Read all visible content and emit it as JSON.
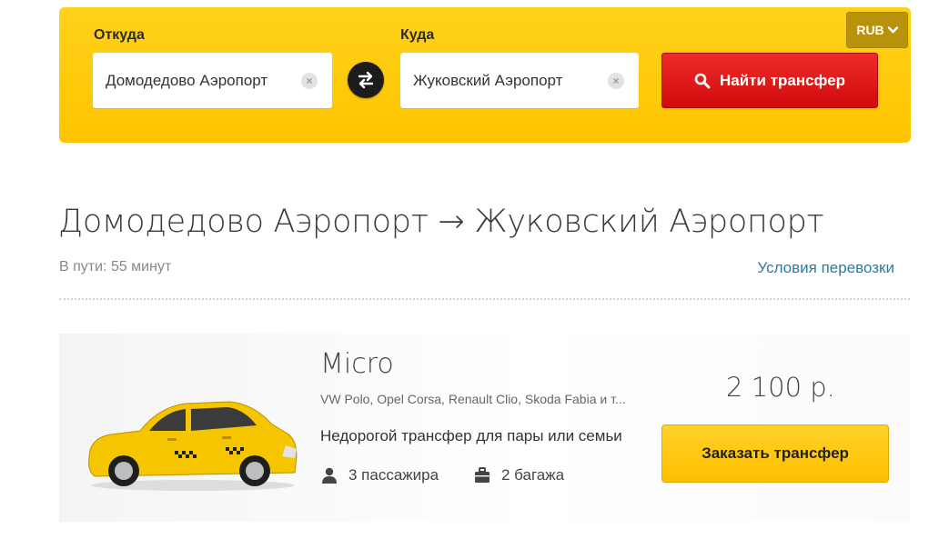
{
  "search": {
    "from_label": "Откуда",
    "from_value": "Домодедово Аэропорт",
    "to_label": "Куда",
    "to_value": "Жуковский Аэропорт",
    "search_button": "Найти трансфер",
    "currency": "RUB"
  },
  "route": {
    "title": "Домодедово Аэропорт → Жуковский Аэропорт",
    "travel_time": "В пути: 55 минут",
    "terms_link": "Условия перевозки"
  },
  "offer": {
    "class_name": "Micro",
    "models": "VW Polo, Opel Corsa, Renault Clio, Skoda Fabia и т...",
    "description": "Недорогой трансфер для пары или семьи",
    "passengers": "3 пассажира",
    "luggage": "2 багажа",
    "price": "2 100 р.",
    "order_button": "Заказать трансфер"
  },
  "icons": {
    "search": "search-icon",
    "swap": "swap-arrows-icon",
    "clear": "clear-icon",
    "chevron": "chevron-down-icon",
    "passenger": "user-icon",
    "luggage": "suitcase-icon",
    "car": "taxi-car-image"
  },
  "colors": {
    "panel": "#ffc400",
    "search_button": "#d10b0b",
    "order_button": "#ffc400",
    "link": "#2a7aa8",
    "currency_button": "#b8920a"
  }
}
